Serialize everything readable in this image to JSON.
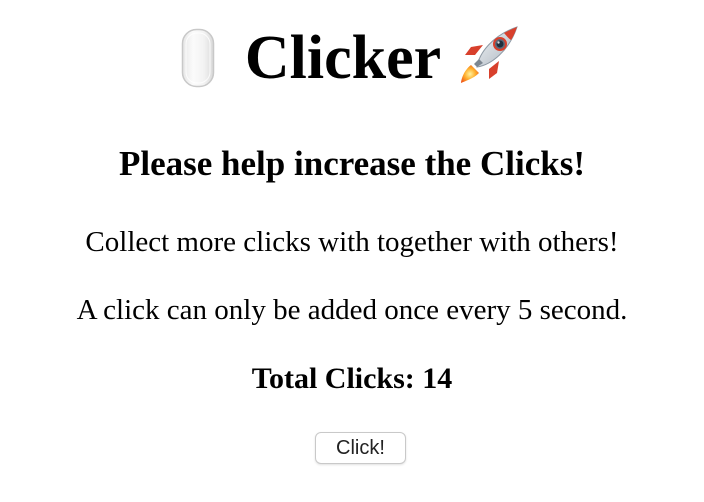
{
  "header": {
    "title": "Clicker",
    "left_icon": "mouse-icon",
    "right_icon": "rocket-icon"
  },
  "main": {
    "subtitle": "Please help increase the Clicks!",
    "description_1": "Collect more clicks with together with others!",
    "description_2": "A click can only be added once every 5 second.",
    "total_label": "Total Clicks: 14",
    "total_clicks": 14,
    "click_button_label": "Click!"
  }
}
